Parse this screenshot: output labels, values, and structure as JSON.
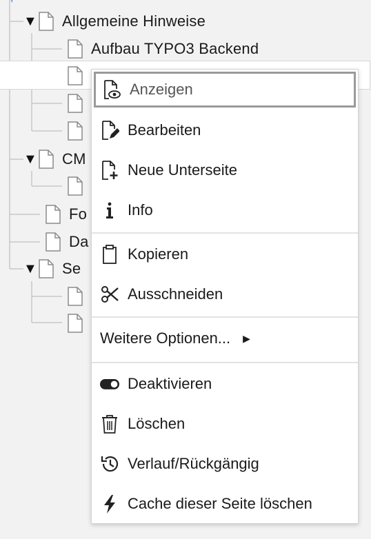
{
  "tree": {
    "nodes": [
      {
        "label": "Allgemeine Hinweise"
      },
      {
        "label": "Aufbau TYPO3 Backend"
      },
      {
        "label": ""
      },
      {
        "label": ""
      },
      {
        "label": ""
      },
      {
        "label": "CM"
      },
      {
        "label": ""
      },
      {
        "label": "Fo"
      },
      {
        "label": "Da"
      },
      {
        "label": "Se"
      },
      {
        "label": ""
      },
      {
        "label": ""
      }
    ],
    "toggle_symbol": "▼"
  },
  "context_menu": {
    "items": {
      "anzeigen": "Anzeigen",
      "bearbeiten": "Bearbeiten",
      "neue_unterseite": "Neue Unterseite",
      "info": "Info",
      "kopieren": "Kopieren",
      "ausschneiden": "Ausschneiden",
      "weitere_optionen": "Weitere Optionen...",
      "deaktivieren": "Deaktivieren",
      "loeschen": "Löschen",
      "verlauf": "Verlauf/Rückgängig",
      "cache": "Cache dieser Seite löschen"
    },
    "submenu_arrow": "▶",
    "icons": {
      "anzeigen": "page-view-icon",
      "bearbeiten": "page-edit-icon",
      "neue_unterseite": "page-new-icon",
      "info": "info-icon",
      "kopieren": "clipboard-icon",
      "ausschneiden": "scissors-icon",
      "deaktivieren": "toggle-icon",
      "loeschen": "trash-icon",
      "verlauf": "history-icon",
      "cache": "lightning-icon"
    }
  }
}
